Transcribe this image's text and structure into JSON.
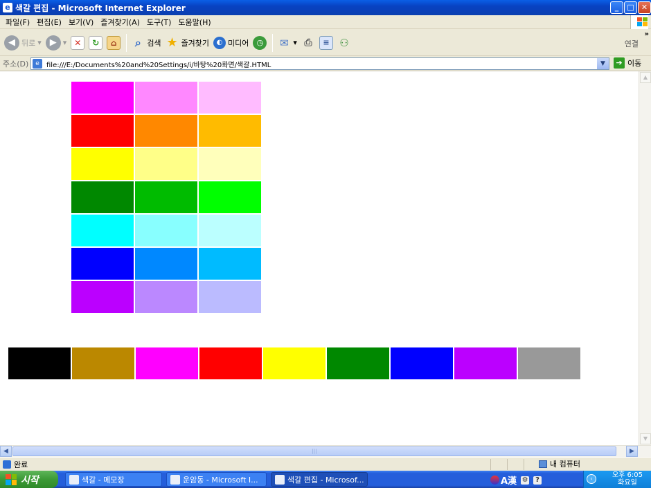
{
  "window": {
    "title": "색갈 편집 - Microsoft Internet Explorer",
    "minimize": "_",
    "maximize": "□",
    "close": "✕"
  },
  "menu": {
    "items": [
      "파일(F)",
      "편집(E)",
      "보기(V)",
      "즐겨찾기(A)",
      "도구(T)",
      "도움말(H)"
    ]
  },
  "toolbar": {
    "back_label": "뒤로",
    "search_label": "검색",
    "favorites_label": "즐겨찾기",
    "media_label": "미디어",
    "links_label": "연결"
  },
  "address": {
    "label": "주소(D)",
    "url": "file:///E:/Documents%20and%20Settings/i/바탕%20화면/색갈.HTML",
    "go_label": "이동"
  },
  "content": {
    "grid_colors": [
      [
        "#ff00ff",
        "#ff88ff",
        "#ffbbff"
      ],
      [
        "#ff0000",
        "#ff8800",
        "#ffbb00"
      ],
      [
        "#ffff00",
        "#ffff88",
        "#ffffbb"
      ],
      [
        "#008800",
        "#00bb00",
        "#00ff00"
      ],
      [
        "#00ffff",
        "#88ffff",
        "#bbffff"
      ],
      [
        "#0000ff",
        "#0088ff",
        "#00bbff"
      ],
      [
        "#bb00ff",
        "#bb88ff",
        "#bbbbff"
      ]
    ],
    "strip_colors": [
      "#000000",
      "#bb8800",
      "#ff00ff",
      "#ff0000",
      "#ffff00",
      "#008800",
      "#0000ff",
      "#bb00ff",
      "#999999"
    ]
  },
  "status": {
    "text": "완료",
    "zone": "내 컴퓨터"
  },
  "taskbar": {
    "start_label": "시작",
    "tasks": [
      {
        "label": "색갈 - 메모장",
        "active": false
      },
      {
        "label": "운암동 - Microsoft I...",
        "active": false
      },
      {
        "label": "색갈 편집 - Microsof...",
        "active": true
      }
    ],
    "ime": "A漢",
    "time": "오후 6:05",
    "day": "화요일"
  }
}
